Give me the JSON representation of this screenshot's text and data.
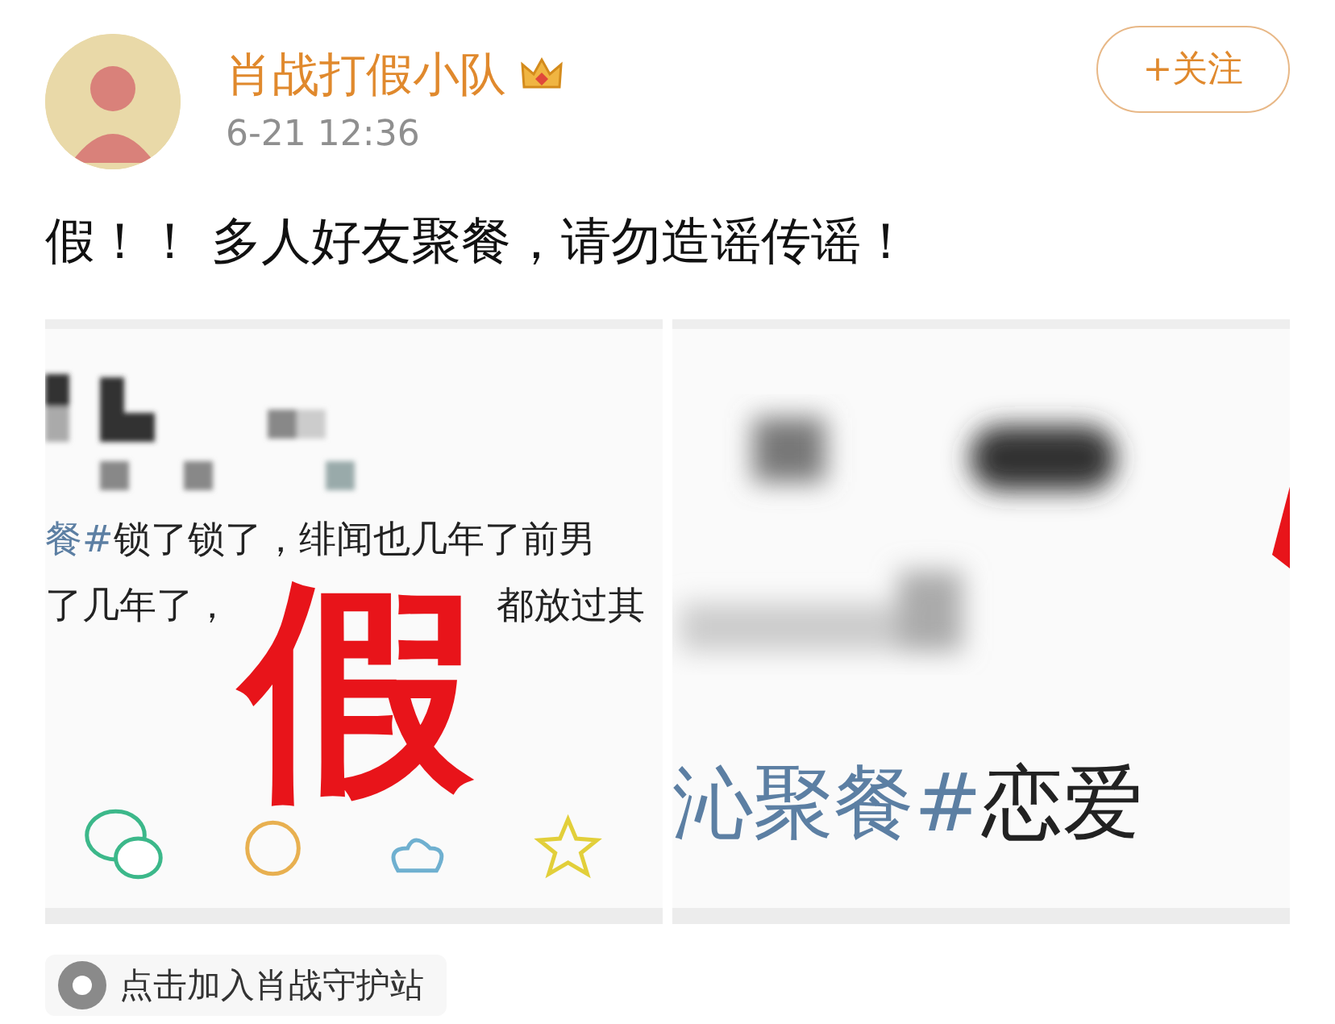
{
  "post": {
    "author": "肖战打假小队",
    "time": "6-21 12:36",
    "follow_button": "+关注",
    "text": "假！！ 多人好友聚餐，请勿造谣传谣！"
  },
  "images": [
    {
      "kind": "post-card",
      "lines": [
        {
          "tag": "餐#",
          "text": "锁了锁了，绯闻也几年了前男"
        },
        {
          "parts": [
            "了几年了，",
            "都放过其"
          ]
        }
      ],
      "stamp": "假"
    },
    {
      "kind": "caption-card",
      "tag": "沁聚餐#",
      "text": "恋爱"
    }
  ],
  "super_topic": {
    "label": "点击加入肖战守护站"
  }
}
